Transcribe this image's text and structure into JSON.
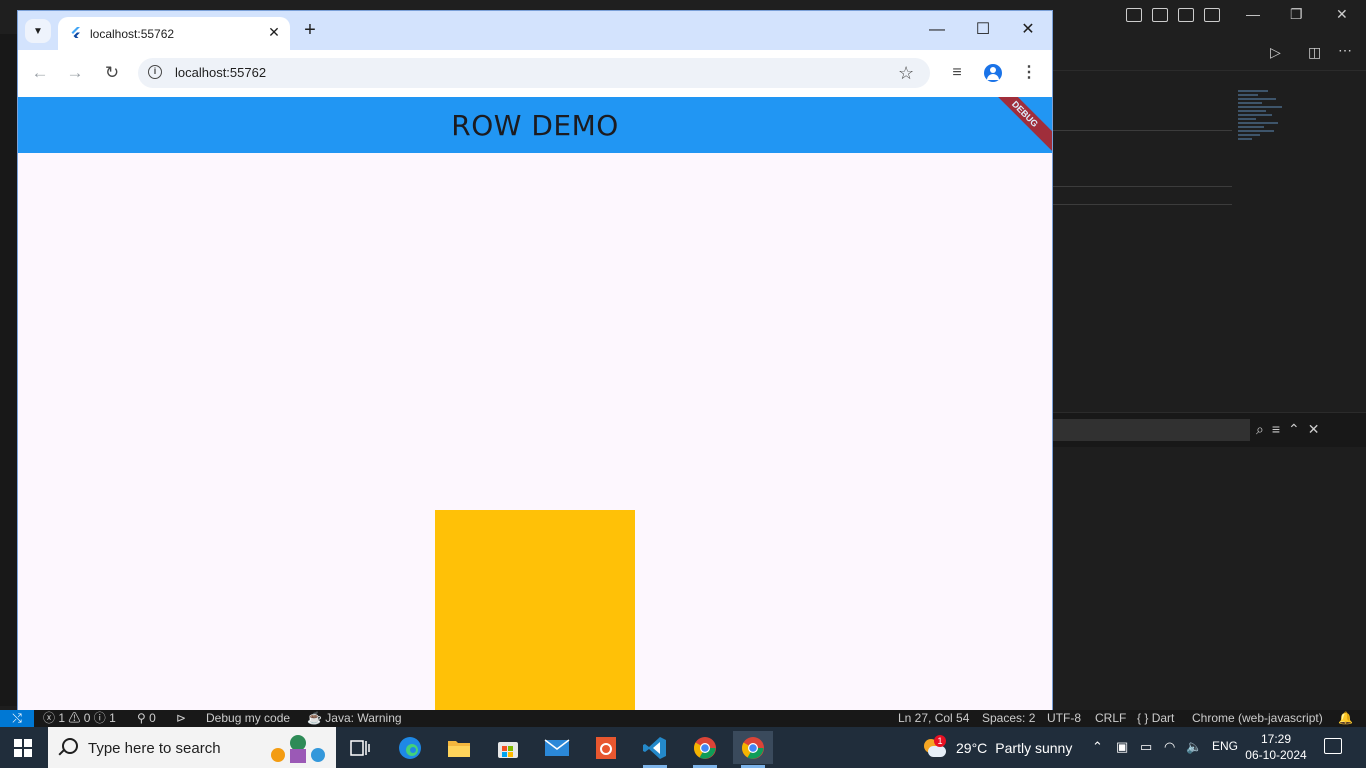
{
  "browser": {
    "tab_title": "localhost:55762",
    "url": "localhost:55762"
  },
  "app": {
    "title": "ROW DEMO",
    "debug_banner": "DEBUG",
    "colors": {
      "appbar": "#2196f3",
      "background": "#fdf7fe",
      "box": "#ffc107",
      "debug_banner": "#b71c1c"
    }
  },
  "statusbar": {
    "errors": "1",
    "warnings": "0",
    "infos": "1",
    "ports": "0",
    "debug_label": "Debug my code",
    "java_status": "Java: Warning",
    "cursor_position": "Ln 27, Col 54",
    "indentation": "Spaces: 2",
    "encoding": "UTF-8",
    "eol": "CRLF",
    "language": "Dart",
    "device": "Chrome (web-javascript)"
  },
  "taskbar": {
    "search_placeholder": "Type here to search",
    "weather_temp": "29°C",
    "weather_desc": "Partly sunny",
    "weather_badge": "1",
    "language": "ENG",
    "time": "17:29",
    "date": "06-10-2024"
  }
}
